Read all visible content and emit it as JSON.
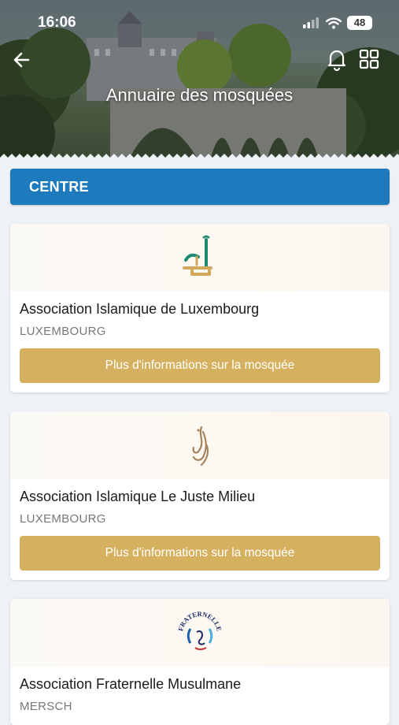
{
  "status_bar": {
    "time": "16:06",
    "battery": "48"
  },
  "header": {
    "title": "Annuaire des mosquées"
  },
  "section": {
    "label": "CENTRE"
  },
  "mosques": [
    {
      "name": "Association Islamique de Luxembourg",
      "city": "LUXEMBOURG",
      "button": "Plus d'informations sur la mosquée"
    },
    {
      "name": "Association Islamique Le Juste Milieu",
      "city": "LUXEMBOURG",
      "button": "Plus d'informations sur la mosquée"
    },
    {
      "name": "Association Fraternelle Musulmane",
      "city": "MERSCH",
      "logo_text": "FRATERNELLE"
    }
  ],
  "colors": {
    "section_bar": "#1c7abd",
    "info_button": "#d5b15f",
    "background": "#eef1f5"
  }
}
